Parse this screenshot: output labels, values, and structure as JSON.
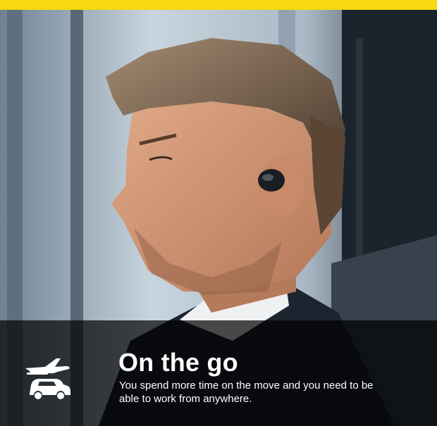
{
  "banner": {
    "accent_color": "#f6d90f",
    "title": "On the go",
    "description": "You spend more time on the move and you need to be able to work from anywhere.",
    "icons": [
      "airplane-icon",
      "car-icon"
    ]
  }
}
